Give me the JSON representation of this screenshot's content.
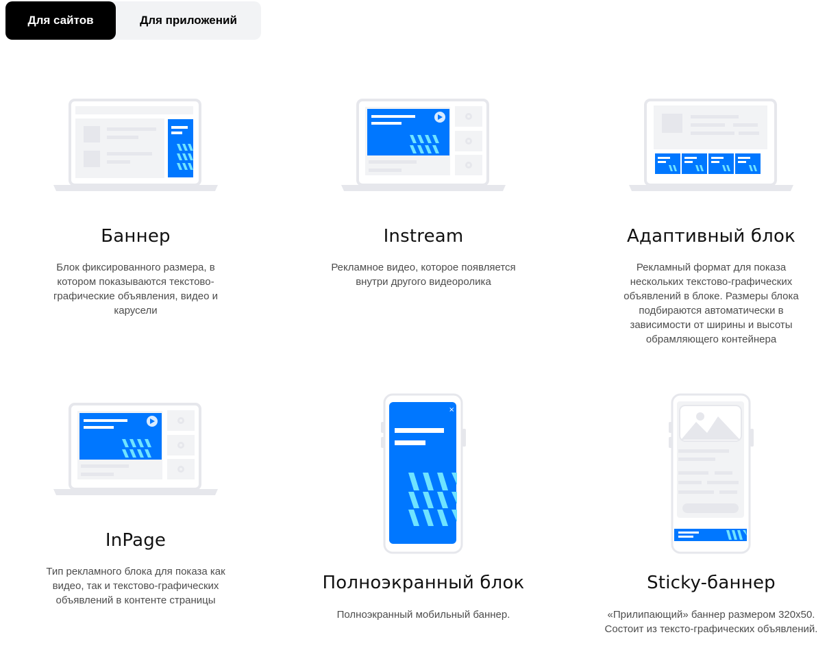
{
  "tabs": [
    {
      "label": "Для сайтов",
      "active": true
    },
    {
      "label": "Для приложений",
      "active": false
    }
  ],
  "colors": {
    "accent": "#0077ff",
    "cyan": "#6fe3ff",
    "device_gray": "#e6e7ec",
    "text_gray": "#4c4c4c"
  },
  "formats": [
    {
      "title": "Баннер",
      "desc": "Блок фиксированного размера, в котором показываются текстово-графические объявления, видео и карусели",
      "illustration": "laptop-banner-icon"
    },
    {
      "title": "Instream",
      "desc": "Рекламное видео, которое появляется внутри другого видеоролика",
      "illustration": "laptop-instream-icon"
    },
    {
      "title": "Адаптивный блок",
      "desc": "Рекламный формат для показа нескольких текстово-графических объявлений в блоке. Размеры блока подбираются автоматически в зависимости от ширины и высоты обрамляющего контейнера",
      "illustration": "laptop-adaptive-icon"
    },
    {
      "title": "InPage",
      "desc": "Тип рекламного блока для показа как видео, так и текстово-графических объявлений в контенте страницы",
      "illustration": "laptop-inpage-icon"
    },
    {
      "title": "Полноэкранный блок",
      "desc": "Полноэкранный мобильный баннер.",
      "illustration": "phone-fullscreen-icon"
    },
    {
      "title": "Sticky-баннер",
      "desc": "«Прилипающий» баннер размером 320х50. Состоит из тексто-графических объявлений.",
      "illustration": "phone-sticky-icon"
    }
  ]
}
